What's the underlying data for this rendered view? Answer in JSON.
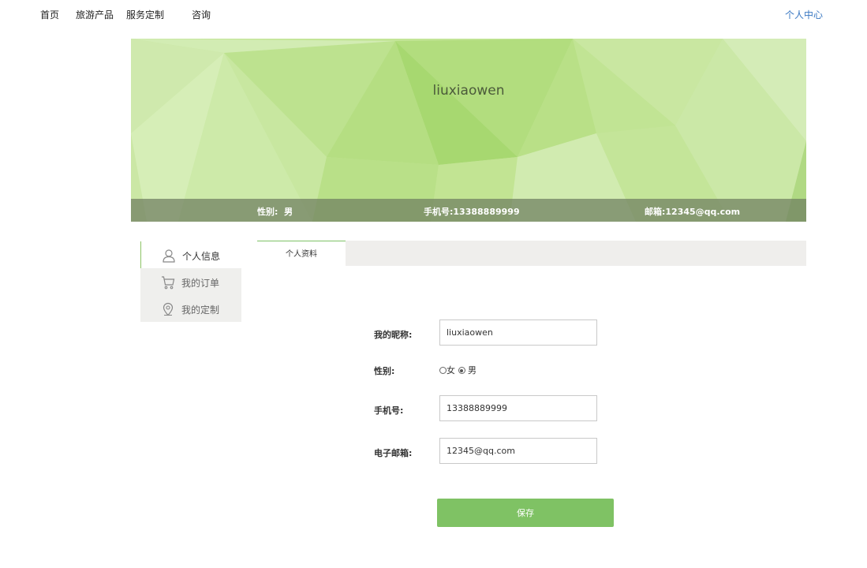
{
  "nav": {
    "home": "首页",
    "products": "旅游产品",
    "custom": "服务定制",
    "consult": "咨询",
    "user_center": "个人中心"
  },
  "banner": {
    "username": "liuxiaowen",
    "gender_label": "性别:",
    "gender_value": "男",
    "phone_label": "手机号:",
    "phone_value": "13388889999",
    "email_label": "邮箱:",
    "email_value": "12345@qq.com"
  },
  "sidebar": {
    "items": [
      {
        "label": "个人信息",
        "icon": "user-icon",
        "active": true
      },
      {
        "label": "我的订单",
        "icon": "cart-icon",
        "active": false
      },
      {
        "label": "我的定制",
        "icon": "location-pin-icon",
        "active": false
      }
    ]
  },
  "tabs": {
    "profile": "个人资料"
  },
  "form": {
    "nickname_label": "我的昵称:",
    "nickname_value": "liuxiaowen",
    "gender_label": "性别:",
    "gender_options": [
      "女",
      "男"
    ],
    "gender_selected": "男",
    "phone_label": "手机号:",
    "phone_value": "13388889999",
    "email_label": "电子邮箱:",
    "email_value": "12345@qq.com",
    "save_label": "保存"
  },
  "colors": {
    "accent": "#7fc264",
    "link": "#3a78c2"
  }
}
